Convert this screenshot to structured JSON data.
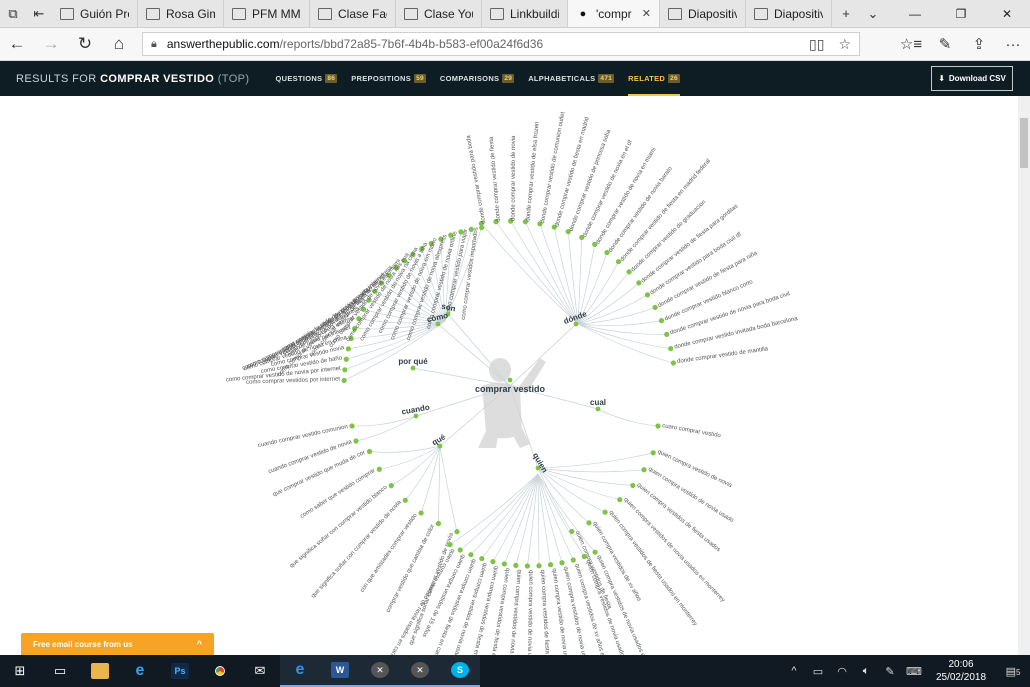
{
  "browser": {
    "tabs": [
      {
        "label": "Guión Proy"
      },
      {
        "label": "Rosa Gimer"
      },
      {
        "label": "PFM MMDI"
      },
      {
        "label": "Clase Faceb"
      },
      {
        "label": "Clase Youtu"
      },
      {
        "label": "Linkbuildin"
      },
      {
        "label": "'compr",
        "active": true
      },
      {
        "label": "Diapositiva"
      },
      {
        "label": "Diapositiva"
      }
    ],
    "url_host": "answerthepublic.com",
    "url_path": "/reports/bbd72a85-7b6f-4b4b-b583-ef00a24f6d36"
  },
  "site": {
    "results_prefix": "RESULTS FOR",
    "keyword": "COMPRAR VESTIDO",
    "results_suffix": "(TOP)",
    "nav": [
      {
        "label": "QUESTIONS",
        "count": "86"
      },
      {
        "label": "PREPOSITIONS",
        "count": "59"
      },
      {
        "label": "COMPARISONS",
        "count": "29"
      },
      {
        "label": "ALPHABETICALS",
        "count": "471"
      },
      {
        "label": "RELATED",
        "count": "26",
        "active": true
      }
    ],
    "download_label": "Download CSV"
  },
  "wheel": {
    "center": "comprar vestido",
    "hubs": [
      {
        "label": "son"
      },
      {
        "label": "cómo"
      },
      {
        "label": "dónde"
      },
      {
        "label": "por qué"
      },
      {
        "label": "cual"
      },
      {
        "label": "cuando"
      },
      {
        "label": "qué"
      },
      {
        "label": "quien"
      }
    ],
    "left_phrases": [
      "como comprar vestidos por internet",
      "como comprar vestido de novia por internet",
      "como comprar vestido de baño",
      "como comprar vestido novia",
      "como comprar vestido de novia en china",
      "como comprar vestido de novia por internet",
      "como comprar vestido de fiesta pela internet",
      "como comprar vestido aliexpress",
      "como comprar vestido de novia en aliexpress",
      "como comprar vestido de novia de china",
      "como comprar vestido de novia por internet",
      "como comprar vestido de novia importado pela internet",
      "como comprar vestido de fiesta no aliexpress",
      "como comprar vestido de novia em miami",
      "como comprar vestido de noiva nos eua",
      "como comprar vestido de noiva na china",
      "como comprar vestido de novia a lima",
      "como comprar vestido de noiva em mano",
      "como comprar vestido de noiva aliexpress",
      "como comprar vestido de novia online",
      "como comprar vestido para viajar",
      "como comprar vestidos importados"
    ],
    "right_phrases": [
      "donde comprar vestido para boda",
      "donde comprar vestido de fiesta",
      "donde comprar vestido de novia",
      "donde comprar vestido de elsa frozen",
      "donde comprar vestido de comunion outlet",
      "donde comprar vestido de fiesta en madrid",
      "donde comprar vestido de princesa sofia",
      "donde comprar vestido de novia en el df",
      "donde comprar vestido de novia en miami",
      "donde comprar vestido de novia barato",
      "donde comprar vestido de fiesta en madrid federal",
      "donde comprar vestido de graduacion",
      "donde comprar vestido de fiesta para gorditas",
      "donde comprar vestido para boda civil df",
      "donde comprar vestido de fiesta para niña",
      "donde comprar vestido blanco corto",
      "donde comprar vestido de novia para boda civil",
      "donde comprar vestido invitada boda barcelona",
      "donde comprar vestido de mantilla"
    ],
    "cual_phrase": "cuaro comprar vestido",
    "cuando_phrases": [
      "cuando comprar vestido comunion",
      "cuando comprar vestido de novia"
    ],
    "que_phrases": [
      "que comprar vestido que muda de cor",
      "como saber que vestido comprar",
      "que significa soñar con comprar vestido blanco",
      "que significa soñar con comprar vestido de novia",
      "con que amistades comprar vestido",
      "comprar vestido que cambia de color",
      "que significa soñar comprar vestido de novia"
    ],
    "quien_right_phrases": [
      "quien compra vestido de novia",
      "quien compra vestido de novia usado",
      "quien compra vestidos de fiesta usados",
      "quien compra vestidos de novia usados en monterrey",
      "quien compra vestidos de fiesta usados en monterrey",
      "quien compra vestidos de xv años",
      "quien compra vestidos de fiesta"
    ],
    "quien_down_phrases": [
      "quien compra vestido de novia usados en caracas",
      "quien compra vestidos de 15 años",
      "quien compra vestidos de fiesta en caracas",
      "quien compra vestidos de novia usados en chile",
      "quien compra vestidos de fiesta en monterrey",
      "quien compra vestidos de fiesta en guatemala",
      "quien compra vestidos de novia usados en guatemala",
      "quien compra vestido de novia usados",
      "quien compra vestidos de fiesta usados",
      "quien compra vestido de novia usado en lima",
      "quien compra vestidos de novia usados en quito",
      "quien compra vestidos de xv años en quito",
      "quien compra vestidos de novia usados en bogota",
      "quien compra vestidos de novia usados en lima"
    ]
  },
  "promo": {
    "label": "Free email course from us"
  },
  "taskbar": {
    "time": "20:06",
    "date": "25/02/2018",
    "notif": "5"
  }
}
